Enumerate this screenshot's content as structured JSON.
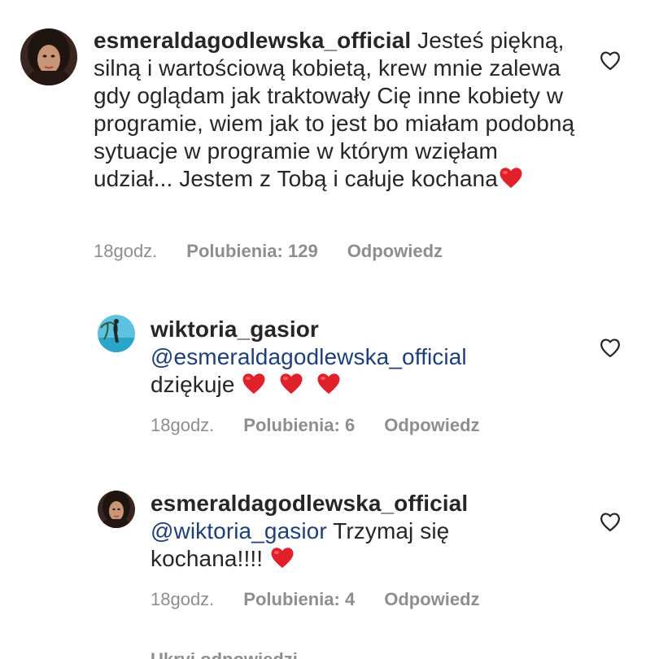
{
  "comments": [
    {
      "username": "esmeraldagodlewska_official",
      "text": "Jesteś piękną, silną i wartościową kobietą, krew mnie zalewa gdy oglądam jak traktowały Cię inne kobiety w programie, wiem jak to jest bo miałam podobną sytuacje w programie w którym wzięłam udział... Jestem z Tobą i całuje kochana",
      "emoji": [
        "red-heart"
      ],
      "time": "18godz.",
      "likes": "Polubienia: 129",
      "reply": "Odpowiedz"
    },
    {
      "username": "wiktoria_gasior",
      "mention": "@esmeraldagodlewska_official",
      "text": "dziękuje",
      "emoji": [
        "red-heart",
        "red-heart",
        "red-heart"
      ],
      "time": "18godz.",
      "likes": "Polubienia: 6",
      "reply": "Odpowiedz"
    },
    {
      "username": "esmeraldagodlewska_official",
      "mention": "@wiktoria_gasior",
      "text_after_mention": " Trzymaj się",
      "text_line2": "kochana!!!!",
      "emoji": [
        "red-heart"
      ],
      "time": "18godz.",
      "likes": "Polubienia: 4",
      "reply": "Odpowiedz"
    }
  ],
  "footer": {
    "hide_replies": "Ukryj odpowiedzi"
  },
  "colors": {
    "mention": "#1e3f78",
    "meta": "#8e8e8e",
    "heart": "#e0202a"
  }
}
